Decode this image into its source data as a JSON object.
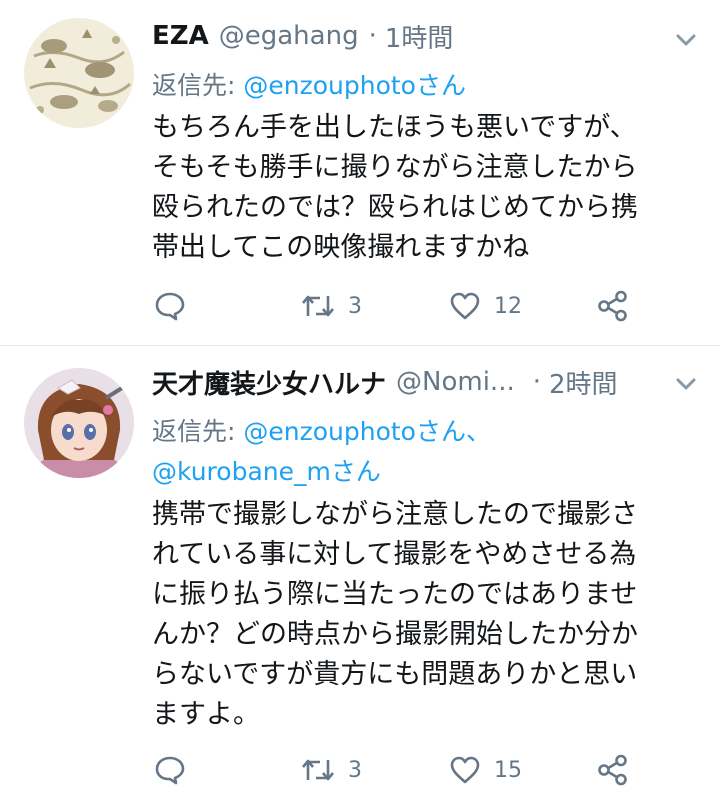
{
  "tweets": [
    {
      "display_name": "EZA",
      "handle": "@egahang",
      "separator": "·",
      "time": "1時間",
      "reply_prefix": "返信先: ",
      "reply_mentions": "@enzouphotoさん",
      "reply_mentions_2": "",
      "body": "もちろん手を出したほうも悪いですが、\nそもそも勝手に撮りながら注意したから\n殴られたのでは？殴られはじめてから携\n帯出してこの映像撮れますかね",
      "reply_count": "",
      "retweet_count": "3",
      "like_count": "12"
    },
    {
      "display_name": "天才魔装少女ハルナ",
      "handle": "@Nomi...",
      "separator": "·",
      "time": "2時間",
      "reply_prefix": "返信先: ",
      "reply_mentions": "@enzouphotoさん、",
      "reply_mentions_2": "@kurobane_mさん",
      "body": "携帯で撮影しながら注意したので撮影さ\nれている事に対して撮影をやめさせる為\nに振り払う際に当たったのではありませ\nんか？どの時点から撮影開始したか分か\nらないですが貴方にも問題ありかと思い\nますよ。",
      "reply_count": "",
      "retweet_count": "3",
      "like_count": "15"
    }
  ],
  "icons": {
    "reply": "speech-bubble-icon",
    "retweet": "retweet-arrows-icon",
    "like": "heart-outline-icon",
    "share": "share-nodes-icon",
    "more": "chevron-down-icon"
  },
  "colors": {
    "text": "#14171a",
    "muted": "#657786",
    "link": "#1da1f2",
    "divider": "#e1e8ed"
  }
}
